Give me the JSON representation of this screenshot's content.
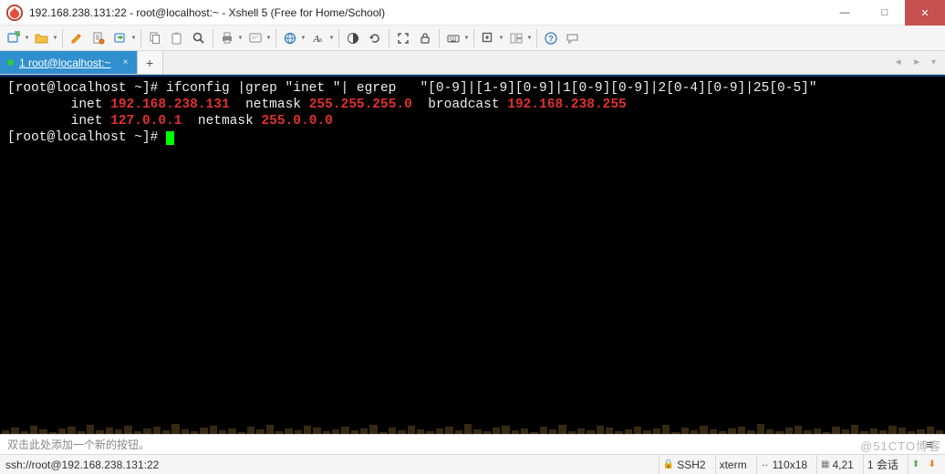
{
  "window": {
    "title": "192.168.238.131:22 - root@localhost:~ - Xshell 5 (Free for Home/School)",
    "minimize": "—",
    "maximize": "□",
    "close": "✕"
  },
  "toolbar": {
    "icons": {
      "new": "new-session-icon",
      "open": "open-folder-icon",
      "pencil": "edit-icon",
      "props": "properties-icon",
      "exchange": "transfer-icon",
      "copy": "copy-icon",
      "paste": "paste-icon",
      "find": "find-icon",
      "print": "print-icon",
      "clear": "clear-screen-icon",
      "globe": "encoding-icon",
      "font": "font-icon",
      "color": "color-scheme-icon",
      "refresh": "reconnect-icon",
      "fullscreen": "fullscreen-icon",
      "lock": "lock-icon",
      "keyboard": "keyboard-icon",
      "addbox": "new-window-icon",
      "layout": "layout-icon",
      "help": "help-icon",
      "chat": "chat-icon"
    }
  },
  "tabs": {
    "items": [
      {
        "label": "1 root@localhost:~"
      }
    ],
    "add": "+",
    "nav": "◄ ►  ▾"
  },
  "terminal": {
    "line1": {
      "prompt": "[root@localhost ~]# ",
      "cmd": "ifconfig |grep \"inet \"| egrep   \"[0-9]|[1-9][0-9]|1[0-9][0-9]|2[0-4][0-9]|25[0-5]\""
    },
    "line2": {
      "indent": "        ",
      "k1": "inet ",
      "v1": "192.168.238.131",
      "k2": "  netmask ",
      "v2": "255.255.255.0",
      "k3": "  broadcast ",
      "v3": "192.168.238.255"
    },
    "line3": {
      "indent": "        ",
      "k1": "inet ",
      "v1": "127.0.0.1",
      "k2": "  netmask ",
      "v2": "255.0.0.0"
    },
    "line4": {
      "prompt": "[root@localhost ~]# "
    }
  },
  "button_hint": "双击此处添加一个新的按钮。",
  "status": {
    "conn": "ssh://root@192.168.238.131:22",
    "ssh": "SSH2",
    "term": "xterm",
    "size": "110x18",
    "pos": "4,21",
    "sess": "1 会话"
  },
  "watermark": "@51CTO博客"
}
